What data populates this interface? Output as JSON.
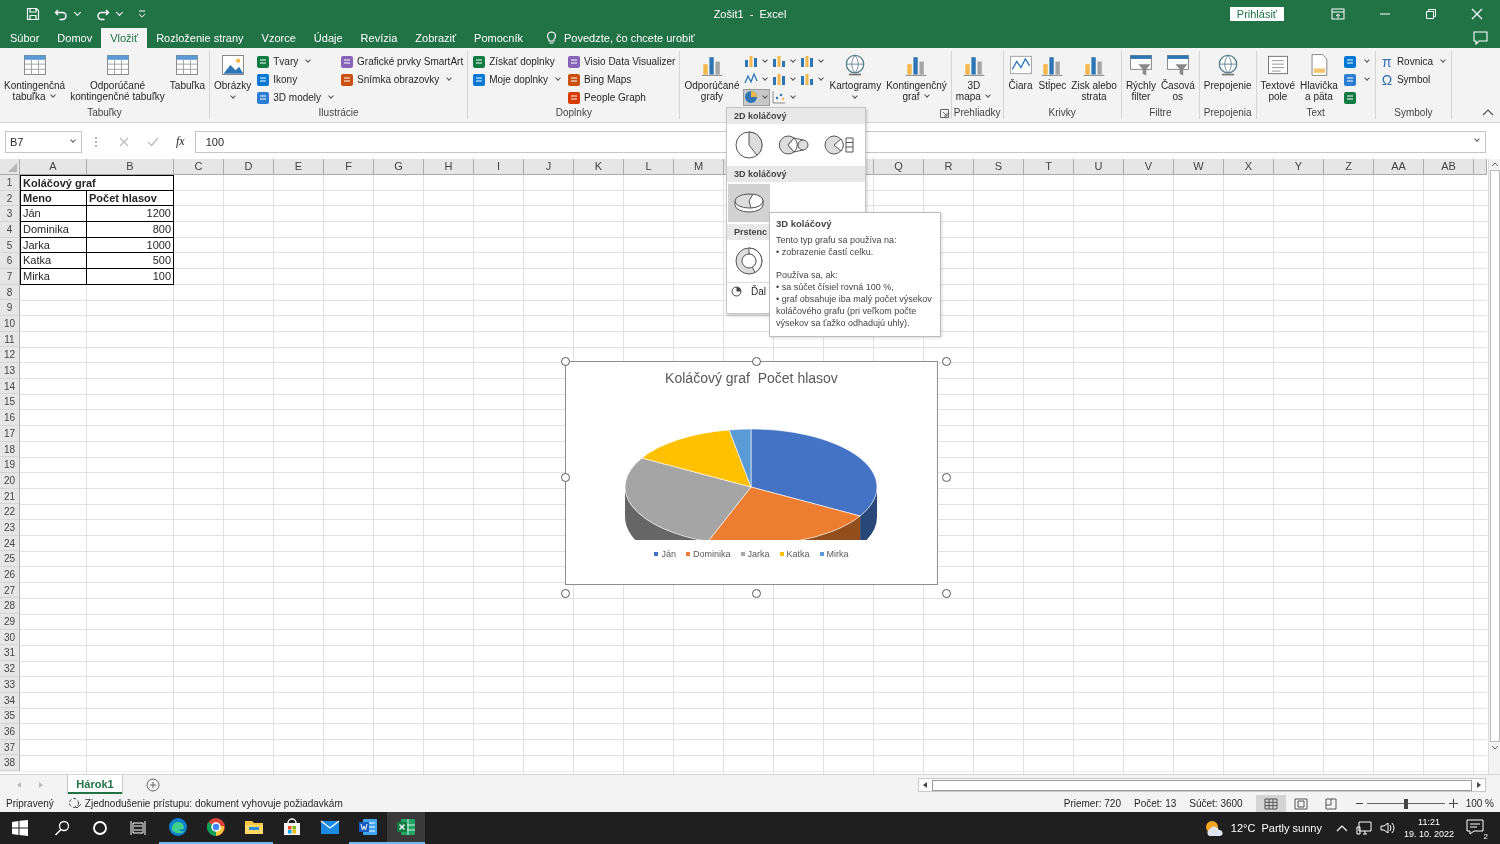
{
  "title_bar": {
    "title": "Zošit1  -  Excel",
    "sign_in": "Prihlásiť"
  },
  "tabs": [
    {
      "label": "Súbor",
      "selected": false
    },
    {
      "label": "Domov",
      "selected": false
    },
    {
      "label": "Vložiť",
      "selected": true
    },
    {
      "label": "Rozloženie strany",
      "selected": false
    },
    {
      "label": "Vzorce",
      "selected": false
    },
    {
      "label": "Údaje",
      "selected": false
    },
    {
      "label": "Revízia",
      "selected": false
    },
    {
      "label": "Zobraziť",
      "selected": false
    },
    {
      "label": "Pomocník",
      "selected": false
    }
  ],
  "tell_me": "Povedzte, čo chcete urobiť",
  "ribbon": {
    "groups": [
      {
        "label": "Tabuľky",
        "launcher": false,
        "items": [
          {
            "kind": "large",
            "lines": [
              "Kontingenčná",
              "tabuľka"
            ],
            "dropdown": true
          },
          {
            "kind": "large",
            "lines": [
              "Odporúčané",
              "kontingenčné tabuľky"
            ],
            "dropdown": false
          },
          {
            "kind": "large",
            "lines": [
              "Tabuľka"
            ],
            "dropdown": false
          }
        ]
      },
      {
        "label": "Ilustrácie",
        "launcher": false,
        "items": [
          {
            "kind": "large",
            "lines": [
              "Obrázky"
            ],
            "dropdown": true
          },
          {
            "kind": "stack",
            "items": [
              {
                "label": "Tvary",
                "dropdown": true
              },
              {
                "label": "Ikony",
                "dropdown": false
              },
              {
                "label": "3D modely",
                "dropdown": true
              }
            ]
          },
          {
            "kind": "stack",
            "items": [
              {
                "label": "Grafické prvky SmartArt",
                "dropdown": false
              },
              {
                "label": "Snímka obrazovky",
                "dropdown": true
              }
            ]
          }
        ]
      },
      {
        "label": "Doplnky",
        "launcher": false,
        "items": [
          {
            "kind": "stack",
            "items": [
              {
                "label": "Získať doplnky",
                "dropdown": false
              },
              {
                "label": "Moje doplnky",
                "dropdown": true
              }
            ]
          },
          {
            "kind": "stack",
            "items": [
              {
                "label": "Visio Data Visualizer",
                "dropdown": false
              },
              {
                "label": "Bing Maps",
                "dropdown": false
              },
              {
                "label": "People Graph",
                "dropdown": false
              }
            ]
          }
        ]
      },
      {
        "launcher": true,
        "items": [
          {
            "kind": "large",
            "lines": [
              "Odporúčané",
              "grafy"
            ],
            "dropdown": false
          },
          {
            "kind": "chart_grid",
            "items": [
              {
                "selected": false
              },
              {
                "selected": false
              },
              {
                "selected": false
              },
              {
                "selected": false
              },
              {
                "selected": false
              },
              {
                "selected": false
              },
              {
                "selected": true
              },
              {
                "selected": false
              }
            ]
          },
          {
            "kind": "large",
            "lines": [
              "Kartogramy"
            ],
            "dropdown": true
          },
          {
            "kind": "large",
            "lines": [
              "Kontingenčný",
              "graf"
            ],
            "dropdown": true
          }
        ]
      },
      {
        "label": "Prehliadky",
        "launcher": false,
        "items": [
          {
            "kind": "large",
            "lines": [
              "3D",
              "mapa"
            ],
            "dropdown": true
          }
        ]
      },
      {
        "label": "Krivky",
        "launcher": false,
        "items": [
          {
            "kind": "large",
            "lines": [
              "Čiara"
            ],
            "dropdown": false
          },
          {
            "kind": "large",
            "lines": [
              "Stĺpec"
            ],
            "dropdown": false
          },
          {
            "kind": "large",
            "lines": [
              "Zisk alebo",
              "strata"
            ],
            "dropdown": false
          }
        ]
      },
      {
        "label": "Filtre",
        "launcher": false,
        "items": [
          {
            "kind": "large",
            "lines": [
              "Rýchly",
              "filter"
            ],
            "dropdown": false
          },
          {
            "kind": "large",
            "lines": [
              "Časová",
              "os"
            ],
            "dropdown": false
          }
        ]
      },
      {
        "label": "Prepojenia",
        "launcher": false,
        "items": [
          {
            "kind": "large",
            "lines": [
              "Prepojenie"
            ],
            "dropdown": false
          }
        ]
      },
      {
        "label": "Text",
        "launcher": false,
        "items": [
          {
            "kind": "large",
            "lines": [
              "Textové",
              "pole"
            ],
            "dropdown": false
          },
          {
            "kind": "large",
            "lines": [
              "Hlavička",
              "a päta"
            ],
            "dropdown": false
          },
          {
            "kind": "stack",
            "items": [
              {
                "dropdown": true
              },
              {
                "dropdown": true
              },
              {
                "dropdown": false
              }
            ]
          }
        ]
      },
      {
        "label": "Symboly",
        "launcher": false,
        "items": [
          {
            "kind": "stack",
            "items": [
              {
                "glyph": "π",
                "label": "Rovnica",
                "dropdown": true
              },
              {
                "glyph": "Ω",
                "label": "Symbol",
                "dropdown": false
              }
            ]
          }
        ]
      }
    ]
  },
  "formula_bar": {
    "name_box": "B7",
    "fx": "fx",
    "value": "100"
  },
  "sheet": {
    "columns_left": [
      "A",
      "B",
      "C",
      "D",
      "E",
      "F",
      "G",
      "H",
      "I",
      "J",
      "K",
      "L",
      "M"
    ],
    "columns_right": [
      "Q",
      "R",
      "S",
      "T",
      "U",
      "V",
      "W",
      "X",
      "Y",
      "Z",
      "AA",
      "AB"
    ],
    "row_numbers": [
      "1",
      "2",
      "3",
      "4",
      "5",
      "6",
      "7",
      "8",
      "9",
      "10",
      "11",
      "12",
      "13",
      "14",
      "15",
      "16",
      "17",
      "18",
      "19",
      "20",
      "21",
      "22",
      "23",
      "24",
      "25",
      "26",
      "27",
      "28",
      "29",
      "30",
      "31",
      "32",
      "33",
      "34",
      "35",
      "36",
      "37",
      "38"
    ],
    "rows": [
      {
        "a": "Koláčový graf",
        "bold": true
      },
      {
        "a": "Meno",
        "b": "Počet hlasov",
        "bold": true
      },
      {
        "a": "Ján",
        "b": "1200",
        "bold": false
      },
      {
        "a": "Dominika",
        "b": "800",
        "bold": false
      },
      {
        "a": "Jarka",
        "b": "1000",
        "bold": false
      },
      {
        "a": "Katka",
        "b": "500",
        "bold": false
      },
      {
        "a": "Mirka",
        "b": "100",
        "bold": false
      }
    ]
  },
  "chart": {
    "title": "Koláčový graf  Počet hlasov",
    "legend": [
      {
        "label": "Ján",
        "color": "#4472c4"
      },
      {
        "label": "Dominika",
        "color": "#ed7d31"
      },
      {
        "label": "Jarka",
        "color": "#a5a5a5"
      },
      {
        "label": "Katka",
        "color": "#ffc000"
      },
      {
        "label": "Mirka",
        "color": "#5b9bd5"
      }
    ]
  },
  "dropdown": {
    "sections": [
      {
        "title": "2D koláčový",
        "items": [
          {
            "selected": false
          },
          {
            "selected": false
          },
          {
            "selected": false
          }
        ]
      },
      {
        "title": "3D koláčový",
        "items": [
          {
            "selected": true
          }
        ]
      },
      {
        "title": "Prstenc",
        "items": [
          {
            "selected": false
          }
        ]
      }
    ],
    "footer": "Ďal"
  },
  "tooltip": {
    "title": "3D koláčový",
    "paragraphs": [
      [
        "Tento typ grafu sa používa na:",
        "• zobrazenie častí celku."
      ],
      [
        "Používa sa, ak:",
        "• sa súčet čísiel rovná 100 %,",
        "• graf obsahuje iba malý počet výsekov koláčového grafu (pri veľkom počte výsekov sa ťažko odhadujú uhly)."
      ]
    ]
  },
  "sheet_tabs": [
    {
      "label": "Hárok1",
      "selected": true
    }
  ],
  "status_bar": {
    "ready": "Pripravený",
    "accessibility": "Zjednodušenie prístupu: dokument vyhovuje požiadavkám",
    "stats": [
      "Priemer: 720",
      "Počet: 13",
      "Súčet: 3600"
    ],
    "views": [
      {
        "selected": true
      },
      {
        "selected": false
      },
      {
        "selected": false
      }
    ],
    "zoom": {
      "level": 0.5,
      "reading": "100 %"
    }
  },
  "taskbar": {
    "apps": [
      {
        "running": true,
        "selected": false
      },
      {
        "running": true,
        "selected": false
      },
      {
        "running": true,
        "selected": false
      },
      {
        "running": false,
        "selected": false
      },
      {
        "running": false,
        "selected": false
      },
      {
        "running": true,
        "selected": false
      },
      {
        "running": true,
        "selected": true
      }
    ],
    "temperature": "12°C",
    "weather": "Partly sunny",
    "time": "11:21",
    "date": "19. 10. 2022",
    "notifications": "2"
  }
}
